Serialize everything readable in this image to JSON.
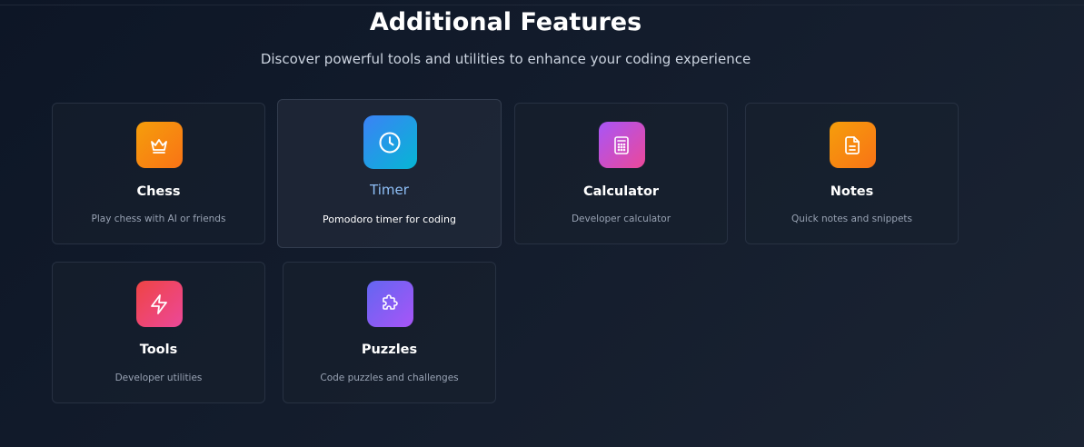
{
  "section": {
    "title": "Additional Features",
    "subtitle": "Discover powerful tools and utilities to enhance your coding experience"
  },
  "features": [
    {
      "title": "Chess",
      "description": "Play chess with AI or friends",
      "icon": "crown-icon",
      "gradient": [
        "#f59e0b",
        "#f97316"
      ]
    },
    {
      "title": "Timer",
      "description": "Pomodoro timer for coding",
      "icon": "clock-icon",
      "gradient": [
        "#3b82f6",
        "#06b6d4"
      ]
    },
    {
      "title": "Calculator",
      "description": "Developer calculator",
      "icon": "calculator-icon",
      "gradient": [
        "#a855f7",
        "#ec4899"
      ]
    },
    {
      "title": "Notes",
      "description": "Quick notes and snippets",
      "icon": "document-icon",
      "gradient": [
        "#f59e0b",
        "#f97316"
      ]
    },
    {
      "title": "Tools",
      "description": "Developer utilities",
      "icon": "lightning-icon",
      "gradient": [
        "#ef4444",
        "#ec4899"
      ]
    },
    {
      "title": "Puzzles",
      "description": "Code puzzles and challenges",
      "icon": "puzzle-icon",
      "gradient": [
        "#6366f1",
        "#a855f7"
      ]
    }
  ]
}
